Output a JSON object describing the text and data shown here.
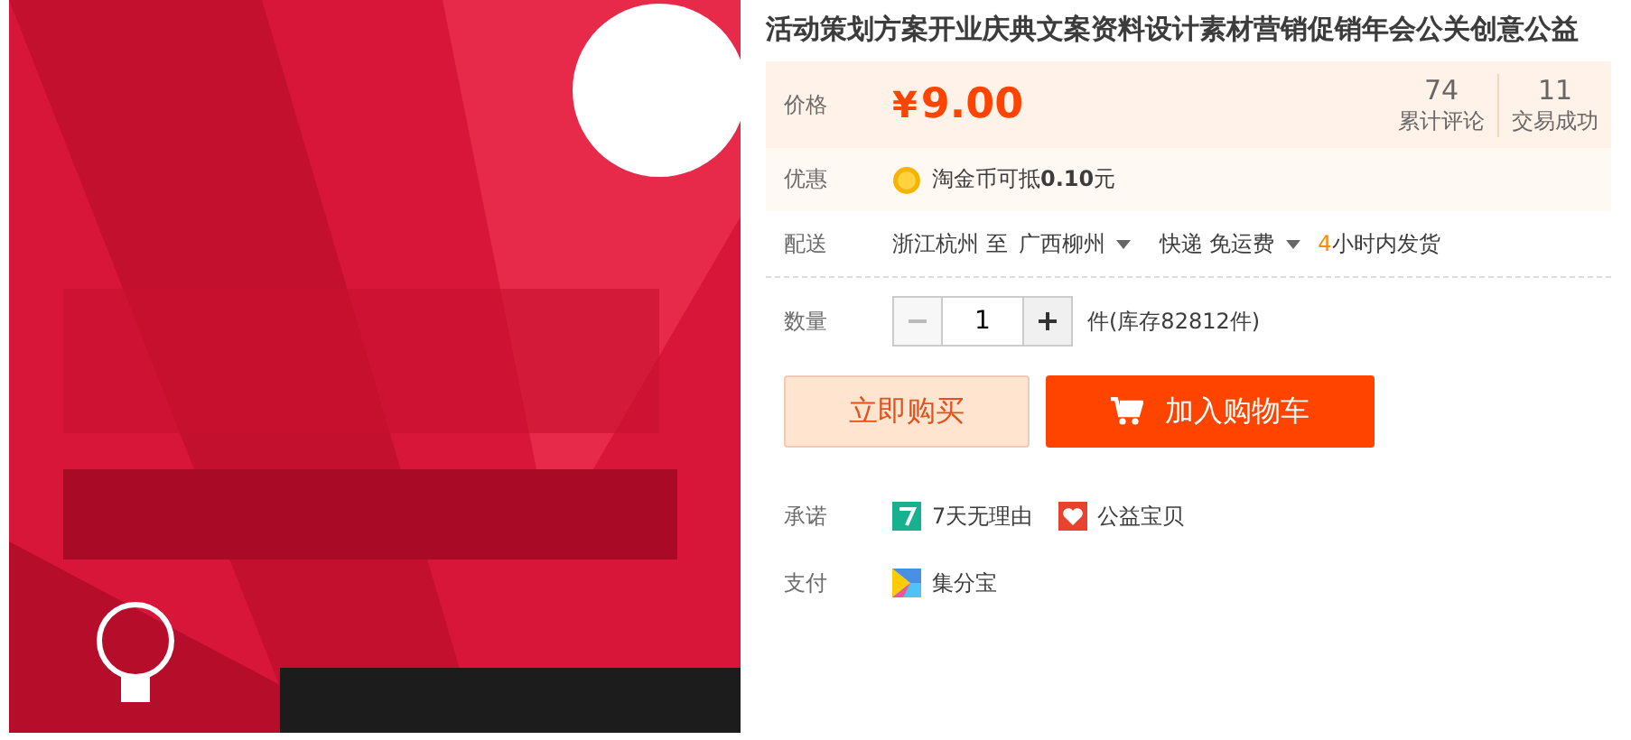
{
  "product": {
    "title": "活动策划方案开业庆典文案资料设计素材营销促销年会公关创意公益"
  },
  "price": {
    "label": "价格",
    "currency": "¥",
    "amount": "9.00",
    "stats": [
      {
        "value": "74",
        "label": "累计评论"
      },
      {
        "value": "11",
        "label": "交易成功"
      }
    ]
  },
  "promo": {
    "label": "优惠",
    "text": "淘金币可抵**0.10**元"
  },
  "delivery": {
    "label": "配送",
    "origin": "浙江杭州 至",
    "destination": "广西柳州",
    "method": "快递 免运费",
    "hours": "4",
    "dispatch": "小时内发货"
  },
  "quantity": {
    "label": "数量",
    "minus_disabled": true,
    "value": "1",
    "stock": "件(库存82812件)"
  },
  "buttons": {
    "buy_now": "立即购买",
    "add_to_cart": "加入购物车"
  },
  "promise": {
    "label": "承诺",
    "items": [
      {
        "kind": "return",
        "text": "7天无理由"
      },
      {
        "kind": "charity",
        "text": "公益宝贝"
      }
    ]
  },
  "payment": {
    "label": "支付",
    "items": [
      {
        "kind": "points",
        "text": "集分宝"
      }
    ]
  }
}
